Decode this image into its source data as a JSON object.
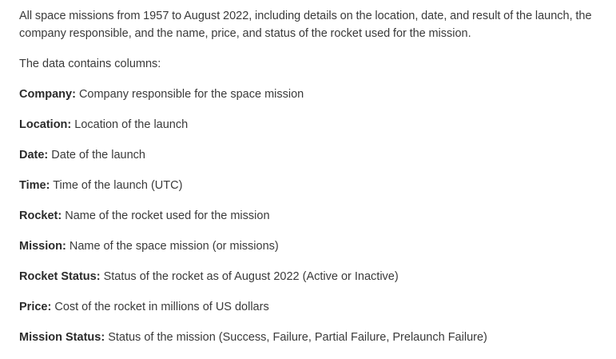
{
  "intro": "All space missions from 1957 to August 2022, including details on the location, date, and result of the launch, the company responsible, and the name, price, and status of the rocket used for the mission.",
  "columns_heading": "The data contains columns:",
  "columns": [
    {
      "name": "Company:",
      "description": "Company responsible for the space mission"
    },
    {
      "name": "Location:",
      "description": "Location of the launch"
    },
    {
      "name": "Date:",
      "description": "Date of the launch"
    },
    {
      "name": "Time:",
      "description": "Time of the launch (UTC)"
    },
    {
      "name": "Rocket:",
      "description": "Name of the rocket used for the mission"
    },
    {
      "name": "Mission:",
      "description": "Name of the space mission (or missions)"
    },
    {
      "name": "Rocket Status:",
      "description": "Status of the rocket as of August 2022 (Active or Inactive)"
    },
    {
      "name": "Price:",
      "description": "Cost of the rocket in millions of US dollars"
    },
    {
      "name": "Mission Status:",
      "description": "Status of the mission (Success, Failure, Partial Failure, Prelaunch Failure)"
    }
  ]
}
